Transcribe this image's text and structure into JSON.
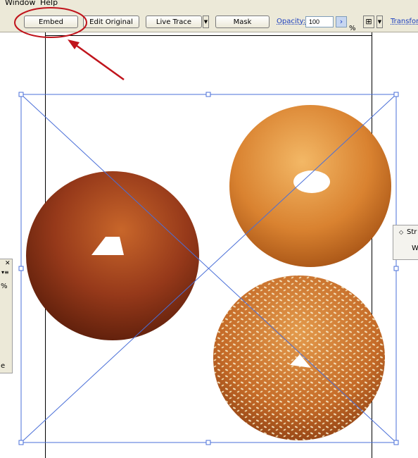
{
  "menubar": {
    "items": [
      "Window",
      "Help"
    ]
  },
  "toolbar": {
    "embed_label": "Embed",
    "edit_original_label": "Edit Original",
    "live_trace_label": "Live Trace",
    "mask_label": "Mask",
    "opacity_label": "Opacity:",
    "opacity_value": "100",
    "percent_symbol": "%",
    "transform_label": "Transfor"
  },
  "panels": {
    "left_percent": "%",
    "left_e": "e",
    "right_title": "Str",
    "right_text": "W"
  },
  "colors": {
    "selection_blue": "#4a6fd8",
    "annotation_red": "#c0141c",
    "link_blue": "#1c3fbf"
  }
}
